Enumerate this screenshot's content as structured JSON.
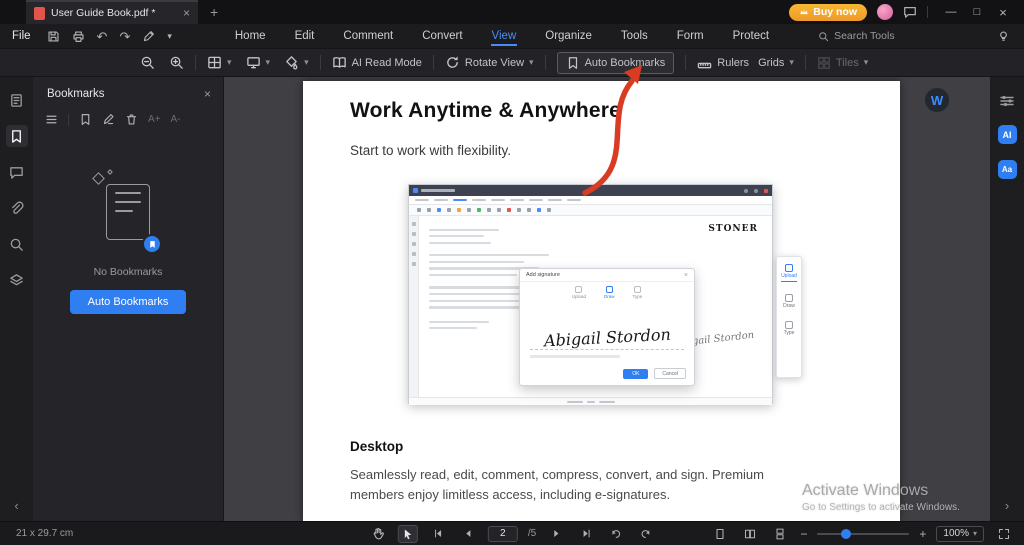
{
  "titlebar": {
    "tab_title": "User Guide Book.pdf *",
    "buy_now_label": "Buy now"
  },
  "icons": {
    "close": "×",
    "minimize": "—",
    "maximize": "□",
    "plus": "+",
    "chevron_down": "▾",
    "chevron_left": "‹",
    "chevron_right": "›",
    "undo": "↶",
    "redo": "↷"
  },
  "menubar": {
    "file_label": "File",
    "tabs": [
      "Home",
      "Edit",
      "Comment",
      "Convert",
      "View",
      "Organize",
      "Tools",
      "Form",
      "Protect"
    ],
    "search_tools_label": "Search Tools"
  },
  "toolbar": {
    "ai_read_mode_label": "AI Read Mode",
    "rotate_view_label": "Rotate View",
    "auto_bookmarks_label": "Auto Bookmarks",
    "rulers_label": "Rulers",
    "grids_label": "Grids",
    "tiles_label": "Tiles"
  },
  "bookmarks_panel": {
    "title": "Bookmarks",
    "empty_text": "No Bookmarks",
    "auto_bookmarks_button_label": "Auto Bookmarks",
    "font_larger": "A+",
    "font_smaller": "A-"
  },
  "rail": {
    "avatar_letter": "W",
    "ai_label": "AI",
    "translate_label": "Aa"
  },
  "document": {
    "heading": "Work Anytime & Anywhere",
    "subheading": "Start to work with flexibility.",
    "section_title": "Desktop",
    "body_line1": "Seamlessly read, edit, comment, compress, convert, and sign. Premium",
    "body_line2": "members enjoy limitless access, including e-signatures.",
    "watermark_line1": "Activate Windows",
    "watermark_line2": "Go to Settings to activate Windows."
  },
  "inner_app": {
    "brand": "STONER",
    "signature": "Abigail Stordon",
    "dialog": {
      "title": "Add signature",
      "tabs": [
        "Upload",
        "Draw",
        "Type"
      ],
      "ok": "OK",
      "cancel": "Cancel"
    },
    "side_tabs": [
      "Upload",
      "Draw",
      "Type"
    ]
  },
  "statusbar": {
    "page_size": "21 x 29.7 cm",
    "page_current": "2",
    "page_total": "/5",
    "zoom_percent": "100%"
  }
}
